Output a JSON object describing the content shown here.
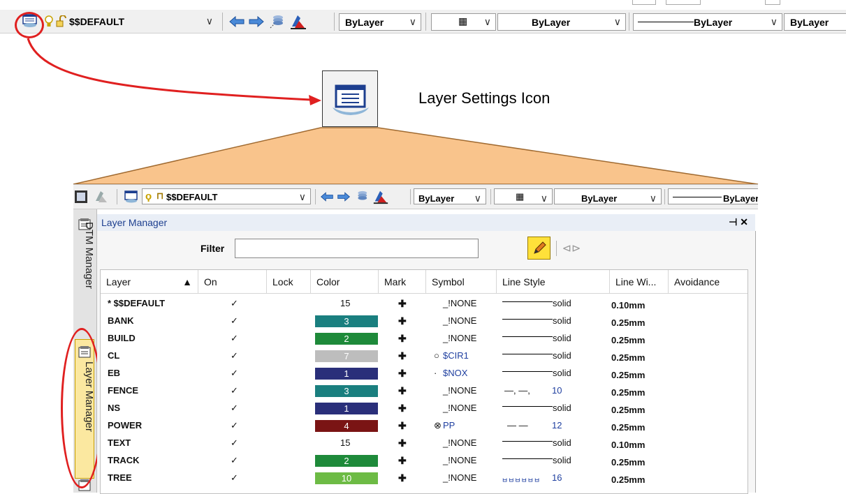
{
  "top_toolbar": {
    "layer_combo": "$$DEFAULT",
    "color_combo": "ByLayer",
    "pattern_combo": "ByLayer",
    "linetype_combo": "ByLayer",
    "lineweight_combo": "ByLayer"
  },
  "callout": {
    "label": "Layer Settings Icon"
  },
  "toolbar2": {
    "layer_combo": "$$DEFAULT",
    "color_combo": "ByLayer",
    "pattern_combo": "ByLayer",
    "linetype_combo": "ByLayer"
  },
  "side_tabs": {
    "dtm": "DTM Manager",
    "layer": "Layer Manager"
  },
  "panel": {
    "title": "Layer Manager",
    "pin_close": "⊣ ✕",
    "filter_label": "Filter",
    "filter_value": ""
  },
  "columns": [
    "Layer",
    "On",
    "Lock",
    "Color",
    "Mark",
    "Symbol",
    "Line Style",
    "Line Wi...",
    "Avoidance"
  ],
  "layers": [
    {
      "name": "* $$DEFAULT",
      "on": "✓",
      "color": "15",
      "color_hex": "",
      "mark": "✚",
      "symbol": "_!NONE",
      "symbol_glyph": "",
      "linestyle": "solid",
      "ls_kind": "solid",
      "width": "0.10mm"
    },
    {
      "name": "BANK",
      "on": "✓",
      "color": "3",
      "color_hex": "#1a7f7f",
      "mark": "✚",
      "symbol": "_!NONE",
      "symbol_glyph": "",
      "linestyle": "solid",
      "ls_kind": "solid",
      "width": "0.25mm"
    },
    {
      "name": "BUILD",
      "on": "✓",
      "color": "2",
      "color_hex": "#1e8a3a",
      "mark": "✚",
      "symbol": "_!NONE",
      "symbol_glyph": "",
      "linestyle": "solid",
      "ls_kind": "solid",
      "width": "0.25mm"
    },
    {
      "name": "CL",
      "on": "✓",
      "color": "7",
      "color_hex": "#bdbdbd",
      "mark": "✚",
      "symbol": "$CIR1",
      "symbol_glyph": "○",
      "linestyle": "solid",
      "ls_kind": "solid",
      "width": "0.25mm"
    },
    {
      "name": "EB",
      "on": "✓",
      "color": "1",
      "color_hex": "#2a2f7a",
      "mark": "✚",
      "symbol": "$NOX",
      "symbol_glyph": "·",
      "linestyle": "solid",
      "ls_kind": "solid",
      "width": "0.25mm"
    },
    {
      "name": "FENCE",
      "on": "✓",
      "color": "3",
      "color_hex": "#1a7f7f",
      "mark": "✚",
      "symbol": "_!NONE",
      "symbol_glyph": "",
      "linestyle": "10",
      "ls_kind": "fence",
      "width": "0.25mm"
    },
    {
      "name": "NS",
      "on": "✓",
      "color": "1",
      "color_hex": "#2a2f7a",
      "mark": "✚",
      "symbol": "_!NONE",
      "symbol_glyph": "",
      "linestyle": "solid",
      "ls_kind": "solid",
      "width": "0.25mm"
    },
    {
      "name": "POWER",
      "on": "✓",
      "color": "4",
      "color_hex": "#7a1414",
      "mark": "✚",
      "symbol": "PP",
      "symbol_glyph": "⊗",
      "linestyle": "12",
      "ls_kind": "dash",
      "width": "0.25mm"
    },
    {
      "name": "TEXT",
      "on": "✓",
      "color": "15",
      "color_hex": "",
      "mark": "✚",
      "symbol": "_!NONE",
      "symbol_glyph": "",
      "linestyle": "solid",
      "ls_kind": "solid",
      "width": "0.10mm"
    },
    {
      "name": "TRACK",
      "on": "✓",
      "color": "2",
      "color_hex": "#1e8a3a",
      "mark": "✚",
      "symbol": "_!NONE",
      "symbol_glyph": "",
      "linestyle": "solid",
      "ls_kind": "solid",
      "width": "0.25mm"
    },
    {
      "name": "TREE",
      "on": "✓",
      "color": "10",
      "color_hex": "#6dbb45",
      "mark": "✚",
      "symbol": "_!NONE",
      "symbol_glyph": "",
      "linestyle": "16",
      "ls_kind": "tree",
      "width": "0.25mm"
    }
  ],
  "colors": {
    "highlight_red": "#e02020",
    "callout_fill": "#f9c48c",
    "callout_stroke": "#a06a30",
    "sidetab_active": "#fbe8a0"
  }
}
